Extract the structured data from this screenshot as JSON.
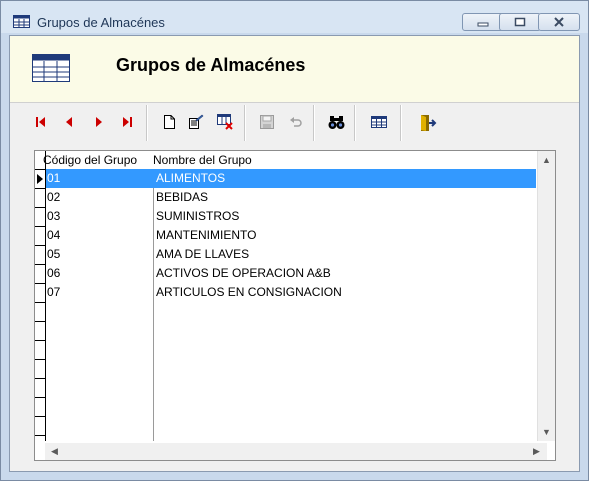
{
  "window": {
    "title": "Grupos de Almacénes",
    "controls": [
      "minimize",
      "maximize",
      "close"
    ]
  },
  "header": {
    "title": "Grupos de Almacénes",
    "icon": "table-icon"
  },
  "toolbar": {
    "buttons": [
      {
        "name": "first-record-icon",
        "enabled": true
      },
      {
        "name": "previous-record-icon",
        "enabled": true
      },
      {
        "name": "next-record-icon",
        "enabled": true
      },
      {
        "name": "last-record-icon",
        "enabled": true
      },
      {
        "name": "new-document-icon",
        "enabled": true
      },
      {
        "name": "edit-record-icon",
        "enabled": true
      },
      {
        "name": "delete-record-icon",
        "enabled": true
      },
      {
        "name": "save-icon",
        "enabled": false
      },
      {
        "name": "undo-icon",
        "enabled": false
      },
      {
        "name": "binoculars-search-icon",
        "enabled": true
      },
      {
        "name": "grid-view-icon",
        "enabled": true
      },
      {
        "name": "exit-door-icon",
        "enabled": true
      }
    ]
  },
  "grid": {
    "columns": [
      "Código del Grupo",
      "Nombre del Grupo"
    ],
    "rows": [
      {
        "code": "01",
        "name": "ALIMENTOS",
        "selected": true
      },
      {
        "code": "02",
        "name": "BEBIDAS"
      },
      {
        "code": "03",
        "name": "SUMINISTROS"
      },
      {
        "code": "04",
        "name": "MANTENIMIENTO"
      },
      {
        "code": "05",
        "name": "AMA DE LLAVES"
      },
      {
        "code": "06",
        "name": "ACTIVOS DE OPERACION A&B"
      },
      {
        "code": "07",
        "name": "ARTICULOS EN CONSIGNACION"
      }
    ]
  },
  "colors": {
    "selection": "#3399ff",
    "header_bg": "#fbfbe7",
    "titlebar_bg": "#d8e5f3"
  }
}
